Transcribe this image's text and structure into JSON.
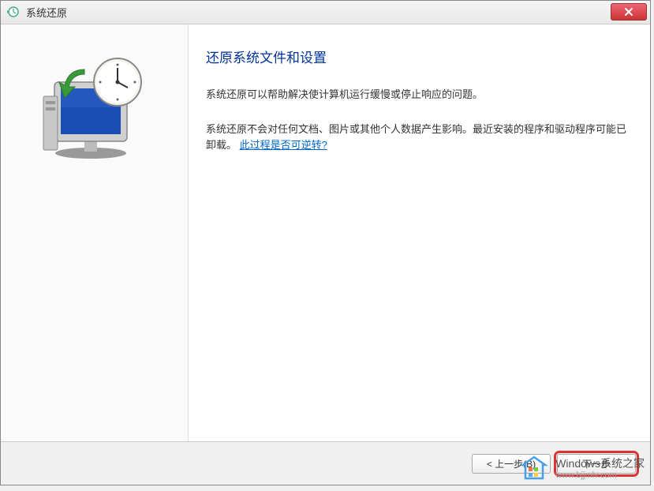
{
  "window": {
    "title": "系统还原"
  },
  "header": {
    "heading": "还原系统文件和设置"
  },
  "body": {
    "paragraph1": "系统还原可以帮助解决使计算机运行缓慢或停止响应的问题。",
    "paragraph2_part1": "系统还原不会对任何文档、图片或其他个人数据产生影响。最近安装的程序和驱动程序可能已卸载。",
    "paragraph2_link": "此过程是否可逆转?"
  },
  "footer": {
    "back_label": "< 上一步(B)",
    "next_label": "下一步"
  },
  "watermark": {
    "title": "Windows系统之家",
    "url": "www.bjjmlv.com"
  }
}
